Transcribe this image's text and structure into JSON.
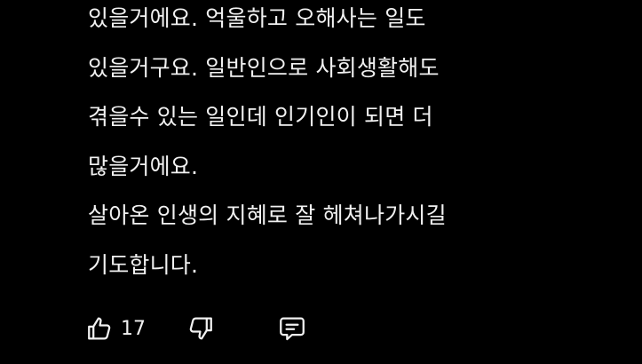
{
  "comment": {
    "lines": [
      "있을거에요. 억울하고 오해사는 일도",
      "있을거구요. 일반인으로 사회생활해도",
      "겪을수 있는 일인데 인기인이 되면 더",
      "많을거에요.",
      "살아온 인생의 지혜로 잘 헤쳐나가시길",
      "기도합니다."
    ]
  },
  "actions": {
    "like_icon": "thumbs-up-icon",
    "like_count": "17",
    "dislike_icon": "thumbs-down-icon",
    "reply_icon": "comment-icon"
  },
  "colors": {
    "background": "#000000",
    "text": "#f1f1f1"
  }
}
